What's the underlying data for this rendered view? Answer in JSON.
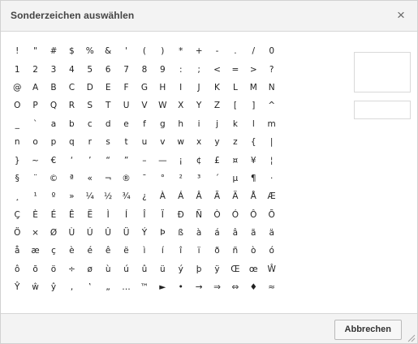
{
  "dialog": {
    "title": "Sonderzeichen auswählen",
    "close_icon": "close-icon",
    "close_glyph": "×"
  },
  "characters": [
    "!",
    "\"",
    "#",
    "$",
    "%",
    "&",
    "'",
    "(",
    ")",
    "*",
    "+",
    "-",
    ".",
    "/",
    "0",
    "1",
    "2",
    "3",
    "4",
    "5",
    "6",
    "7",
    "8",
    "9",
    ":",
    ";",
    "<",
    "=",
    ">",
    "?",
    "@",
    "A",
    "B",
    "C",
    "D",
    "E",
    "F",
    "G",
    "H",
    "I",
    "J",
    "K",
    "L",
    "M",
    "N",
    "O",
    "P",
    "Q",
    "R",
    "S",
    "T",
    "U",
    "V",
    "W",
    "X",
    "Y",
    "Z",
    "[",
    "]",
    "^",
    "_",
    "`",
    "a",
    "b",
    "c",
    "d",
    "e",
    "f",
    "g",
    "h",
    "i",
    "j",
    "k",
    "l",
    "m",
    "n",
    "o",
    "p",
    "q",
    "r",
    "s",
    "t",
    "u",
    "v",
    "w",
    "x",
    "y",
    "z",
    "{",
    "|",
    "}",
    "~",
    "€",
    "‘",
    "’",
    "“",
    "”",
    "–",
    "—",
    "¡",
    "¢",
    "£",
    "¤",
    "¥",
    "¦",
    "§",
    "¨",
    "©",
    "ª",
    "«",
    "¬",
    "®",
    "¯",
    "°",
    "²",
    "³",
    "´",
    "µ",
    "¶",
    "·",
    "¸",
    "¹",
    "º",
    "»",
    "¼",
    "½",
    "¾",
    "¿",
    "À",
    "Á",
    "Â",
    "Ã",
    "Ä",
    "Å",
    "Æ",
    "Ç",
    "È",
    "É",
    "Ê",
    "Ë",
    "Ì",
    "Í",
    "Î",
    "Ï",
    "Ð",
    "Ñ",
    "Ò",
    "Ó",
    "Ô",
    "Õ",
    "Ö",
    "×",
    "Ø",
    "Ù",
    "Ú",
    "Û",
    "Ü",
    "Ý",
    "Þ",
    "ß",
    "à",
    "á",
    "â",
    "ã",
    "ä",
    "å",
    "æ",
    "ç",
    "è",
    "é",
    "ê",
    "ë",
    "ì",
    "í",
    "î",
    "ï",
    "ð",
    "ñ",
    "ò",
    "ó",
    "ô",
    "õ",
    "ö",
    "÷",
    "ø",
    "ù",
    "ú",
    "û",
    "ü",
    "ý",
    "þ",
    "ÿ",
    "Œ",
    "œ",
    "Ŵ",
    "Ŷ",
    "ŵ",
    "ŷ",
    "‚",
    "‛",
    "„",
    "…",
    "™",
    "►",
    "•",
    "→",
    "⇒",
    "⇔",
    "♦",
    "≈"
  ],
  "footer": {
    "cancel_label": "Abbrechen",
    "resize_icon": "resize-grip-icon"
  },
  "colors": {
    "titlebar_bg": "#f3f3f3",
    "border": "#d1d1d1",
    "text": "#222222"
  }
}
